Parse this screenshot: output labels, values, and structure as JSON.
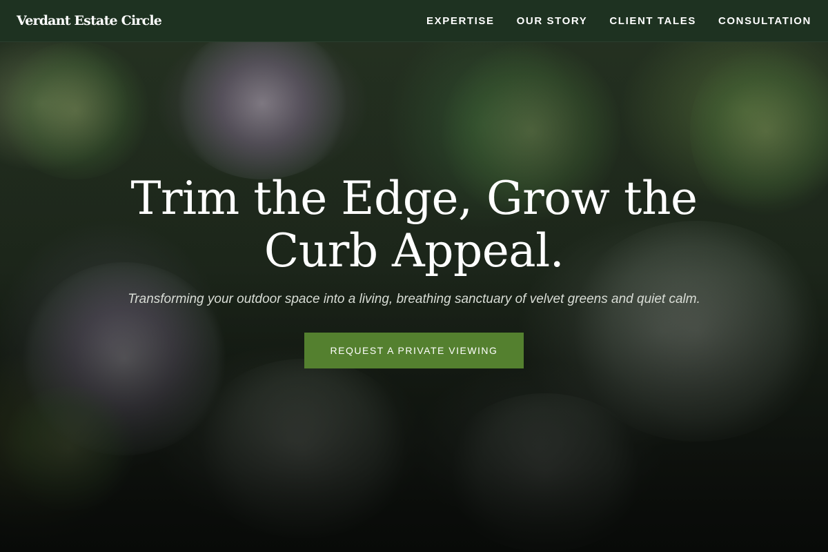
{
  "header": {
    "brand": "Verdant Estate Circle",
    "nav": [
      {
        "label": "EXPERTISE"
      },
      {
        "label": "OUR STORY"
      },
      {
        "label": "CLIENT TALES"
      },
      {
        "label": "CONSULTATION"
      }
    ],
    "background_color": "#1e3221"
  },
  "hero": {
    "headline": "Trim the Edge, Grow the Curb Appeal.",
    "subheadline": "Transforming your outdoor space into a living, breathing sanctuary of velvet greens and quiet calm.",
    "cta_label": "REQUEST A PRIVATE VIEWING",
    "cta_color": "#54802f"
  }
}
